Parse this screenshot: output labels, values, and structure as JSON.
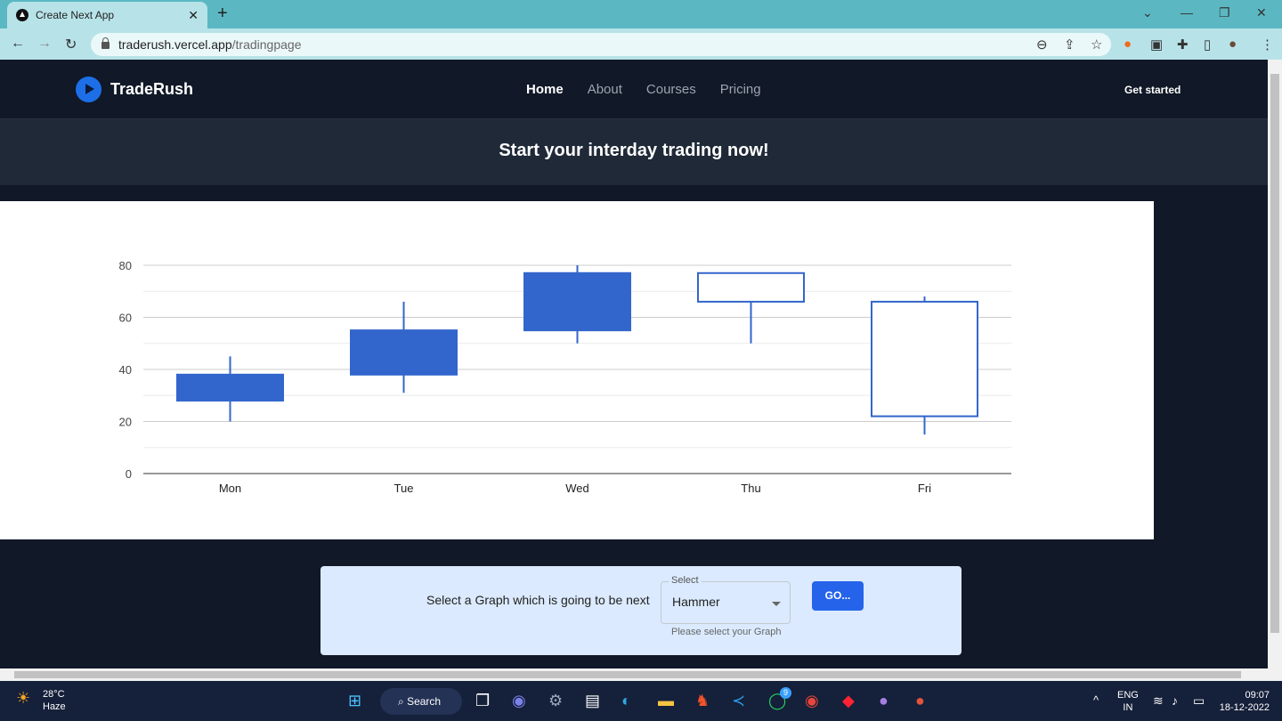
{
  "browser": {
    "tab_title": "Create Next App",
    "url_host": "traderush.vercel.app",
    "url_path": "/tradingpage"
  },
  "navbar": {
    "brand": "TradeRush",
    "links": [
      "Home",
      "About",
      "Courses",
      "Pricing"
    ],
    "active": "Home",
    "cta": "Get started"
  },
  "hero": {
    "title": "Start your interday trading now!"
  },
  "chart_data": {
    "type": "candlestick",
    "categories": [
      "Mon",
      "Tue",
      "Wed",
      "Thu",
      "Fri"
    ],
    "series": [
      {
        "low": 20,
        "open": 28,
        "close": 38,
        "high": 45
      },
      {
        "low": 31,
        "open": 38,
        "close": 55,
        "high": 66
      },
      {
        "low": 50,
        "open": 55,
        "close": 77,
        "high": 80
      },
      {
        "low": 50,
        "open": 77,
        "close": 66,
        "high": 77
      },
      {
        "low": 15,
        "open": 66,
        "close": 22,
        "high": 68
      }
    ],
    "yticks": [
      0,
      20,
      40,
      60,
      80
    ],
    "ylim": [
      0,
      80
    ],
    "grid": true,
    "color": "#3366cc"
  },
  "form": {
    "prompt": "Select a Graph which is going to be next",
    "select_label": "Select",
    "select_value": "Hammer",
    "helper": "Please select your Graph",
    "button": "GO..."
  },
  "taskbar": {
    "temp": "28°C",
    "weather": "Haze",
    "search": "Search",
    "badge": "9",
    "lang1": "ENG",
    "lang2": "IN",
    "time": "09:07",
    "date": "18-12-2022"
  }
}
